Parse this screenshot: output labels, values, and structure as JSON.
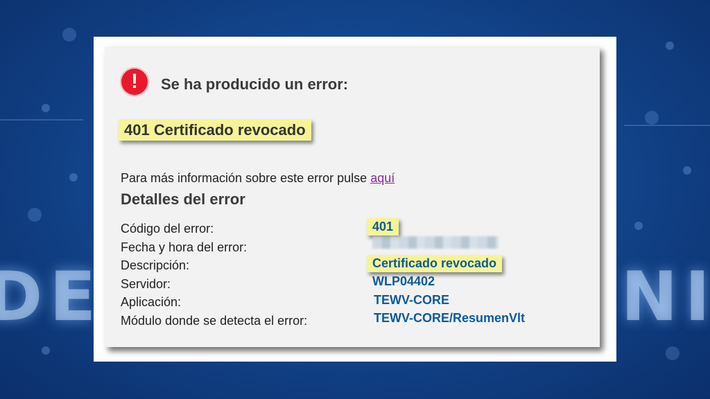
{
  "error_box": {
    "title": "Se ha producido un error:",
    "icon": "exclamation-circle-icon",
    "error_code_title": "401 Certificado revocado",
    "info_text": "Para más información sobre este error pulse",
    "info_link": "aquí",
    "details_heading": "Detalles del error",
    "details": [
      {
        "label": "Código del error:",
        "value": "401"
      },
      {
        "label": "Fecha y hora del error:",
        "value": ""
      },
      {
        "label": "Descripción:",
        "value": "Certificado revocado"
      },
      {
        "label": "Servidor:",
        "value": "WLP04402"
      },
      {
        "label": "Aplicación:",
        "value": "TEWV-CORE"
      },
      {
        "label": "Módulo donde se detecta el error:",
        "value": "TEWV-CORE/ResumenVlt"
      }
    ]
  },
  "colors": {
    "highlight": "#f7f496",
    "value_text": "#0a5b9b",
    "error_icon": "#e8192c",
    "link": "#8a2ba0"
  }
}
